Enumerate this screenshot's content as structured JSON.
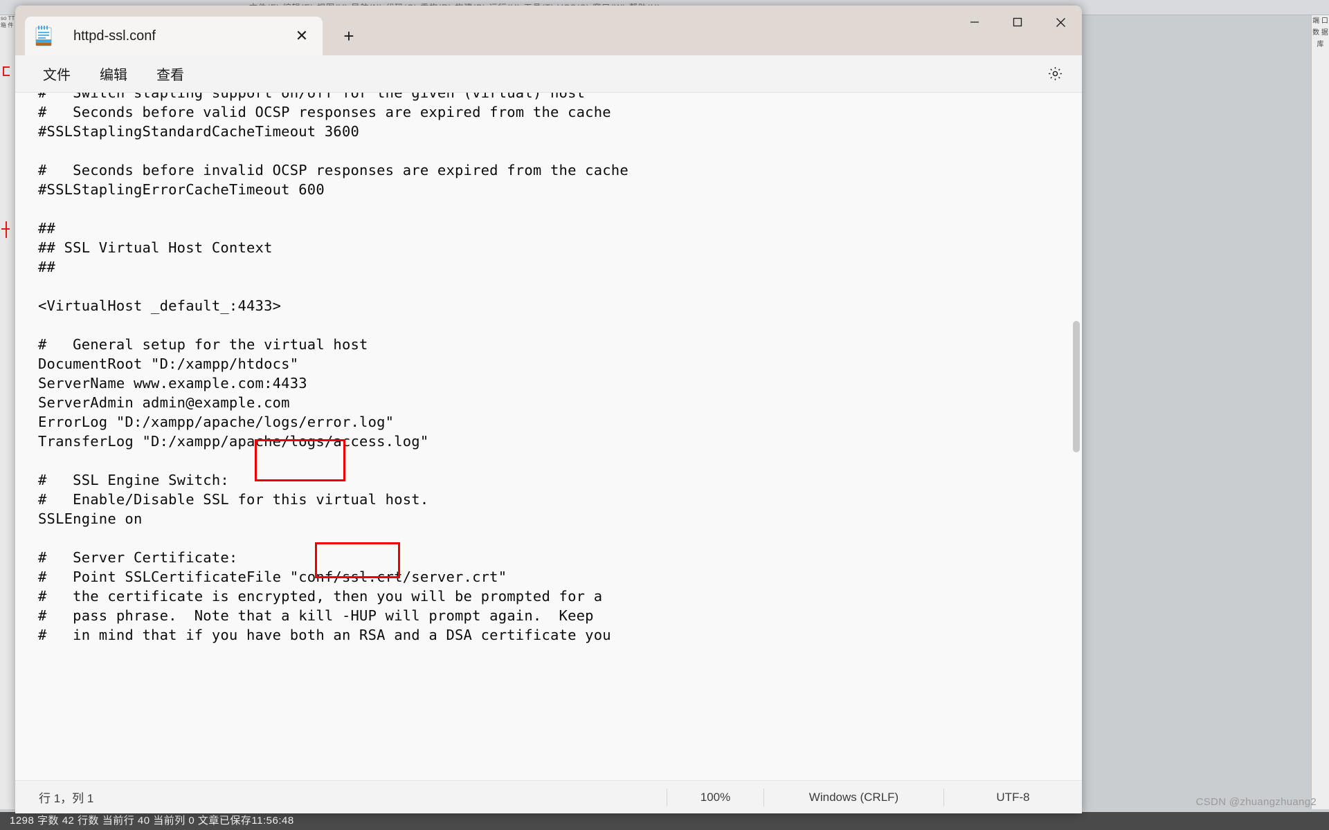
{
  "window": {
    "app_icon": "notepad-icon",
    "tab_title": "httpd-ssl.conf",
    "close_tab_glyph": "✕",
    "new_tab_glyph": "+",
    "minimize_label": "minimize",
    "maximize_label": "maximize",
    "close_label": "close"
  },
  "menubar": {
    "items": [
      {
        "label": "文件",
        "name": "menu-file"
      },
      {
        "label": "编辑",
        "name": "menu-edit"
      },
      {
        "label": "查看",
        "name": "menu-view"
      }
    ],
    "settings_icon": "gear-icon"
  },
  "editor": {
    "clipped_top_line": "#   Switch stapling support on/off for the given (virtual) host",
    "lines": [
      "#   Seconds before valid OCSP responses are expired from the cache",
      "#SSLStaplingStandardCacheTimeout 3600",
      "",
      "#   Seconds before invalid OCSP responses are expired from the cache",
      "#SSLStaplingErrorCacheTimeout 600",
      "",
      "##",
      "## SSL Virtual Host Context",
      "##",
      "",
      "<VirtualHost _default_:4433>",
      "",
      "#   General setup for the virtual host",
      "DocumentRoot \"D:/xampp/htdocs\"",
      "ServerName www.example.com:4433",
      "ServerAdmin admin@example.com",
      "ErrorLog \"D:/xampp/apache/logs/error.log\"",
      "TransferLog \"D:/xampp/apache/logs/access.log\"",
      "",
      "#   SSL Engine Switch:",
      "#   Enable/Disable SSL for this virtual host.",
      "SSLEngine on",
      "",
      "#   Server Certificate:",
      "#   Point SSLCertificateFile \"conf/ssl.crt/server.crt\"",
      "#   the certificate is encrypted, then you will be prompted for a",
      "#   pass phrase.  Note that a kill -HUP will prompt again.  Keep",
      "#   in mind that if you have both an RSA and a DSA certificate you"
    ],
    "annotations": [
      {
        "name": "redbox-virtualhost-port",
        "target_text": ":4433>",
        "color": "#ef0000"
      },
      {
        "name": "redbox-servername-port",
        "target_text": ":4433",
        "color": "#ef0000"
      }
    ]
  },
  "statusbar": {
    "cursor": "行 1，列 1",
    "zoom": "100%",
    "line_ending": "Windows (CRLF)",
    "encoding": "UTF-8"
  },
  "background_app": {
    "toolbar_text": "文件(F)  编辑(E)  视图(V)  导航(N)  代码(C)  重构(R)  构建(B)  运行(U)  工具(T)  VCS(S)  窗口(W)  帮助(H)",
    "status_text": "1298 字数  42 行数  当前行 40  当前列 0  文章已保存11:56:48",
    "left_rail_text": "so\nTT箱\n件",
    "right_rail_text": "端\n口\n数\n据\n库"
  },
  "watermark": {
    "text": "CSDN @zhuangzhuang2"
  },
  "colors": {
    "accent_red": "#ef0000",
    "window_bg": "#f3f3f3",
    "editor_bg": "#f9f9f9",
    "titlebar_bg": "#dfd8d3",
    "tab_bg": "#f7f5f3"
  }
}
